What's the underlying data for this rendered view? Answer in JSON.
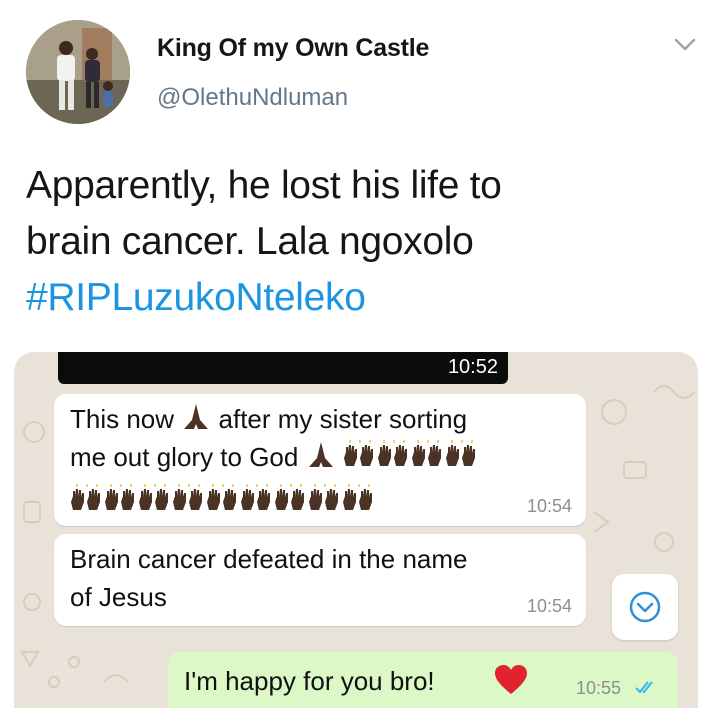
{
  "user": {
    "display_name": "King Of my Own Castle",
    "handle": "@OlethuNdluman"
  },
  "tweet": {
    "line1": "Apparently, he lost his life to",
    "line2": "brain cancer. Lala ngoxolo",
    "hashtag": "#RIPLuzukoNteleko"
  },
  "chat": {
    "status_time": "10:52",
    "messages": [
      {
        "line1_before": "This now",
        "line1_after": "after my sister sorting",
        "line2": "me out  glory to God",
        "time": "10:54"
      },
      {
        "line1": "Brain cancer defeated in the name",
        "line2": "of Jesus",
        "time": "10:54"
      },
      {
        "text": "I'm happy for you bro!",
        "time": "10:55"
      }
    ]
  },
  "colors": {
    "hashtag": "#1b95e0",
    "handle": "#657786",
    "outgoing_bubble": "#dcf8c6",
    "chat_background": "#e9e2d8",
    "read_receipt": "#34b7f1"
  },
  "icons": {
    "tweet_menu": "chevron-down-icon",
    "emoji_prayer": "folded-hands-icon",
    "emoji_praise": "raised-hands-icon",
    "emoji_heart": "red-heart-icon",
    "scroll_down": "circle-chevron-down-icon",
    "read_receipt": "double-check-icon"
  }
}
